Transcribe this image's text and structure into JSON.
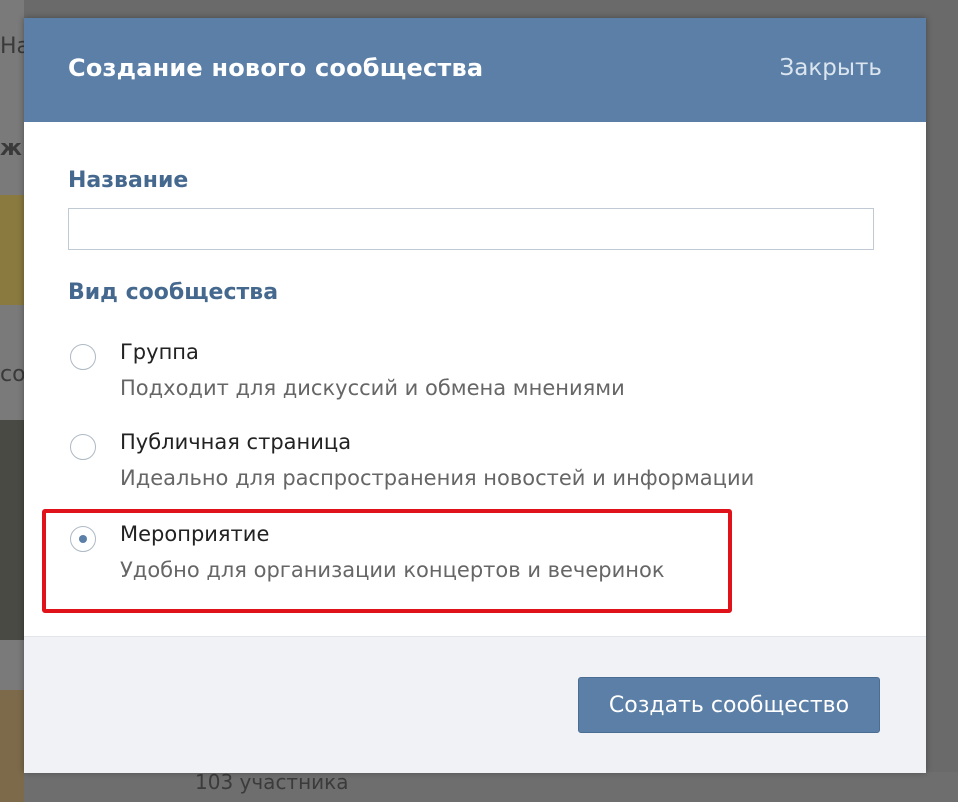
{
  "background": {
    "frag_top": "На",
    "frag_mid": "ж",
    "frag_left": "со",
    "bottom_text": "103 участника"
  },
  "modal": {
    "title": "Создание нового сообщества",
    "close_label": "Закрыть",
    "name_label": "Название",
    "name_value": "",
    "type_label": "Вид сообщества",
    "options": [
      {
        "title": "Группа",
        "description": "Подходит для дискуссий и обмена мнениями",
        "selected": false
      },
      {
        "title": "Публичная страница",
        "description": "Идеально для распространения новостей и информации",
        "selected": false
      },
      {
        "title": "Мероприятие",
        "description": "Удобно для организации концертов и вечеринок",
        "selected": true
      }
    ],
    "submit_label": "Создать сообщество"
  },
  "colors": {
    "header": "#5b7fa6",
    "label": "#45688e",
    "highlight": "#e0121a"
  }
}
